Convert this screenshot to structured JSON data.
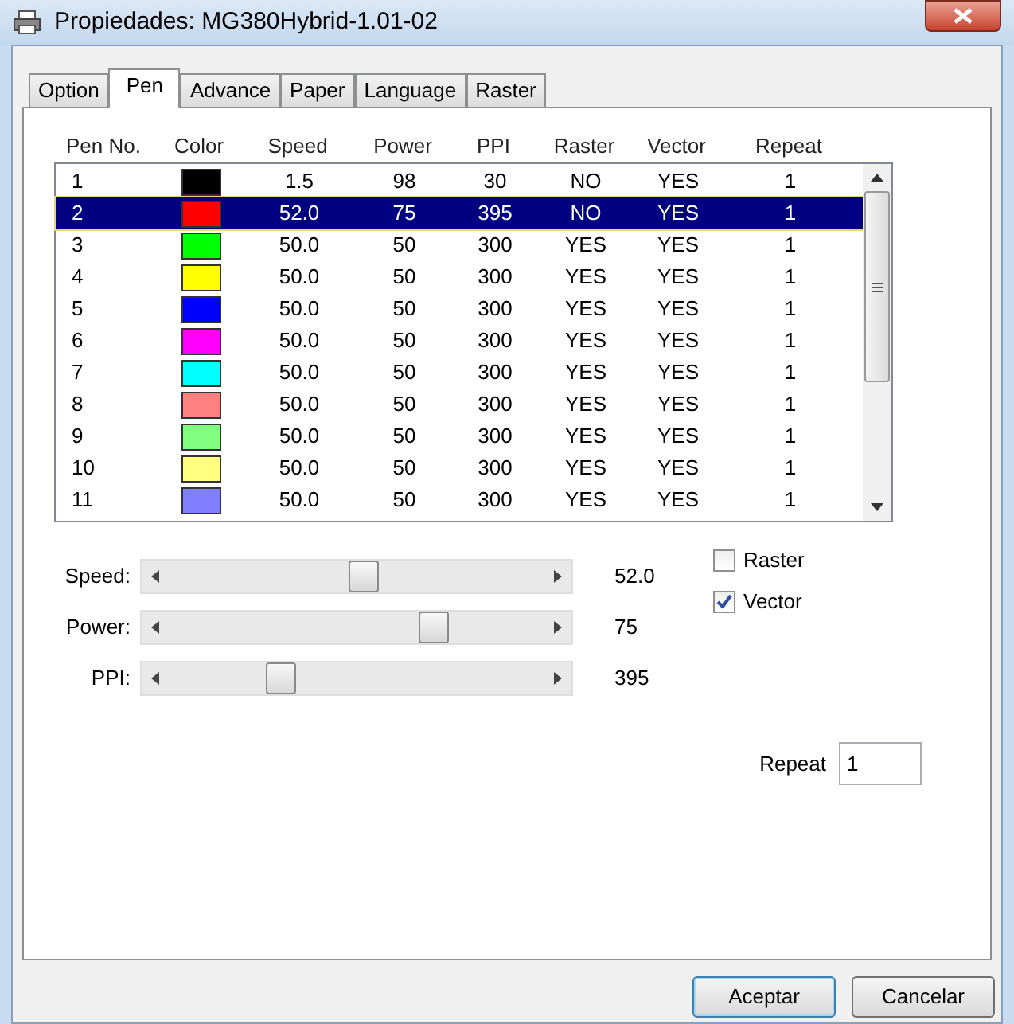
{
  "window": {
    "title": "Propiedades: MG380Hybrid-1.01-02"
  },
  "tabs": [
    {
      "label": "Option",
      "selected": false
    },
    {
      "label": "Pen",
      "selected": true
    },
    {
      "label": "Advance",
      "selected": false
    },
    {
      "label": "Paper",
      "selected": false
    },
    {
      "label": "Language",
      "selected": false
    },
    {
      "label": "Raster",
      "selected": false
    }
  ],
  "pen_table": {
    "columns": [
      "Pen No.",
      "Color",
      "Speed",
      "Power",
      "PPI",
      "Raster",
      "Vector",
      "Repeat"
    ],
    "rows": [
      {
        "pen": "1",
        "color": "#000000",
        "speed": "1.5",
        "power": "98",
        "ppi": "30",
        "raster": "NO",
        "vector": "YES",
        "repeat": "1",
        "selected": false
      },
      {
        "pen": "2",
        "color": "#ff0000",
        "speed": "52.0",
        "power": "75",
        "ppi": "395",
        "raster": "NO",
        "vector": "YES",
        "repeat": "1",
        "selected": true
      },
      {
        "pen": "3",
        "color": "#00ff00",
        "speed": "50.0",
        "power": "50",
        "ppi": "300",
        "raster": "YES",
        "vector": "YES",
        "repeat": "1",
        "selected": false
      },
      {
        "pen": "4",
        "color": "#ffff00",
        "speed": "50.0",
        "power": "50",
        "ppi": "300",
        "raster": "YES",
        "vector": "YES",
        "repeat": "1",
        "selected": false
      },
      {
        "pen": "5",
        "color": "#0000ff",
        "speed": "50.0",
        "power": "50",
        "ppi": "300",
        "raster": "YES",
        "vector": "YES",
        "repeat": "1",
        "selected": false
      },
      {
        "pen": "6",
        "color": "#ff00ff",
        "speed": "50.0",
        "power": "50",
        "ppi": "300",
        "raster": "YES",
        "vector": "YES",
        "repeat": "1",
        "selected": false
      },
      {
        "pen": "7",
        "color": "#00ffff",
        "speed": "50.0",
        "power": "50",
        "ppi": "300",
        "raster": "YES",
        "vector": "YES",
        "repeat": "1",
        "selected": false
      },
      {
        "pen": "8",
        "color": "#ff8080",
        "speed": "50.0",
        "power": "50",
        "ppi": "300",
        "raster": "YES",
        "vector": "YES",
        "repeat": "1",
        "selected": false
      },
      {
        "pen": "9",
        "color": "#80ff80",
        "speed": "50.0",
        "power": "50",
        "ppi": "300",
        "raster": "YES",
        "vector": "YES",
        "repeat": "1",
        "selected": false
      },
      {
        "pen": "10",
        "color": "#ffff80",
        "speed": "50.0",
        "power": "50",
        "ppi": "300",
        "raster": "YES",
        "vector": "YES",
        "repeat": "1",
        "selected": false
      },
      {
        "pen": "11",
        "color": "#8080ff",
        "speed": "50.0",
        "power": "50",
        "ppi": "300",
        "raster": "YES",
        "vector": "YES",
        "repeat": "1",
        "selected": false
      }
    ]
  },
  "sliders": [
    {
      "label": "Speed:",
      "level": 0.52,
      "reading": "52.0"
    },
    {
      "label": "Power:",
      "level": 0.72,
      "reading": "75"
    },
    {
      "label": "PPI:",
      "level": 0.28,
      "reading": "395"
    }
  ],
  "checkboxes": [
    {
      "label": "Raster",
      "checked": false
    },
    {
      "label": "Vector",
      "checked": true
    }
  ],
  "repeat": {
    "label": "Repeat",
    "value": "1"
  },
  "buttons": [
    "Aceptar",
    "Cancelar"
  ]
}
